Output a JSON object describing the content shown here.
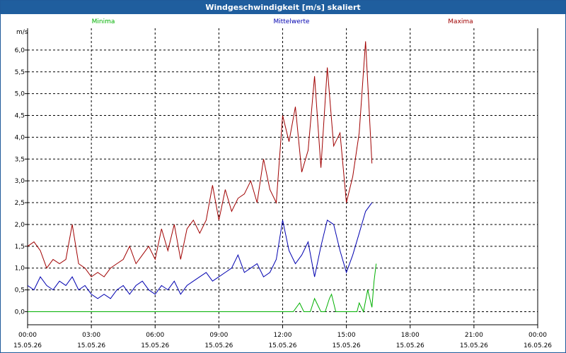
{
  "window": {
    "title": "Windgeschwindigkeit [m/s] skaliert"
  },
  "chart_data": {
    "type": "line",
    "ylabel": "m/s",
    "ylim": [
      -0.3,
      6.5
    ],
    "yticks": [
      "0,0",
      "0,5",
      "1,0",
      "1,5",
      "2,0",
      "2,5",
      "3,0",
      "3,5",
      "4,0",
      "4,5",
      "5,0",
      "5,5",
      "6,0"
    ],
    "ytick_values": [
      0,
      0.5,
      1,
      1.5,
      2,
      2.5,
      3,
      3.5,
      4,
      4.5,
      5,
      5.5,
      6
    ],
    "xlim_hours": [
      0,
      24
    ],
    "xticks": [
      {
        "time": "00:00",
        "date": "15.05.26"
      },
      {
        "time": "03:00",
        "date": "15.05.26"
      },
      {
        "time": "06:00",
        "date": "15.05.26"
      },
      {
        "time": "09:00",
        "date": "15.05.26"
      },
      {
        "time": "12:00",
        "date": "15.05.26"
      },
      {
        "time": "15:00",
        "date": "15.05.26"
      },
      {
        "time": "18:00",
        "date": "15.05.26"
      },
      {
        "time": "21:00",
        "date": "15.05.26"
      },
      {
        "time": "00:00",
        "date": "16.05.26"
      }
    ],
    "grid": true,
    "legend_placement": "top",
    "series": [
      {
        "name": "Minima",
        "color": "#00b000",
        "x": [
          0,
          12,
          12.5,
          12.8,
          13,
          13.3,
          13.5,
          13.8,
          14,
          14.2,
          14.3,
          14.5,
          14.8,
          15,
          15.2,
          15.5,
          15.6,
          15.8,
          16,
          16.2,
          16.3,
          16.4
        ],
        "y": [
          0,
          0,
          0,
          0.2,
          0,
          0,
          0.3,
          0,
          0,
          0.3,
          0.4,
          0,
          0,
          0,
          0,
          0,
          0.2,
          0,
          0.5,
          0.1,
          0.7,
          1.1
        ]
      },
      {
        "name": "Mittelwerte",
        "color": "#0000b0",
        "x": [
          0,
          0.3,
          0.6,
          0.9,
          1.2,
          1.5,
          1.8,
          2.1,
          2.4,
          2.7,
          3,
          3.3,
          3.6,
          3.9,
          4.2,
          4.5,
          4.8,
          5.1,
          5.4,
          5.7,
          6,
          6.3,
          6.6,
          6.9,
          7.2,
          7.5,
          7.8,
          8.1,
          8.4,
          8.7,
          9,
          9.3,
          9.6,
          9.9,
          10.2,
          10.5,
          10.8,
          11.1,
          11.4,
          11.7,
          12,
          12.3,
          12.6,
          12.9,
          13.2,
          13.5,
          13.8,
          14.1,
          14.4,
          14.7,
          15,
          15.3,
          15.6,
          15.9,
          16.2
        ],
        "y": [
          0.6,
          0.5,
          0.8,
          0.6,
          0.5,
          0.7,
          0.6,
          0.8,
          0.5,
          0.6,
          0.4,
          0.3,
          0.4,
          0.3,
          0.5,
          0.6,
          0.4,
          0.6,
          0.7,
          0.5,
          0.4,
          0.6,
          0.5,
          0.7,
          0.4,
          0.6,
          0.7,
          0.8,
          0.9,
          0.7,
          0.8,
          0.9,
          1.0,
          1.3,
          0.9,
          1.0,
          1.1,
          0.8,
          0.9,
          1.2,
          2.1,
          1.4,
          1.1,
          1.3,
          1.6,
          0.8,
          1.5,
          2.1,
          2.0,
          1.4,
          0.9,
          1.3,
          1.8,
          2.3,
          2.5
        ]
      },
      {
        "name": "Maxima",
        "color": "#a00000",
        "x": [
          0,
          0.3,
          0.6,
          0.9,
          1.2,
          1.5,
          1.8,
          2.1,
          2.4,
          2.7,
          3,
          3.3,
          3.6,
          3.9,
          4.2,
          4.5,
          4.8,
          5.1,
          5.4,
          5.7,
          6,
          6.3,
          6.6,
          6.9,
          7.2,
          7.5,
          7.8,
          8.1,
          8.4,
          8.7,
          9,
          9.3,
          9.6,
          9.9,
          10.2,
          10.5,
          10.8,
          11.1,
          11.4,
          11.7,
          12,
          12.3,
          12.6,
          12.9,
          13.2,
          13.5,
          13.8,
          14.1,
          14.4,
          14.7,
          15,
          15.3,
          15.6,
          15.9,
          16.2
        ],
        "y": [
          1.5,
          1.6,
          1.4,
          1.0,
          1.2,
          1.1,
          1.2,
          2.0,
          1.1,
          1.0,
          0.8,
          0.9,
          0.8,
          1.0,
          1.1,
          1.2,
          1.5,
          1.1,
          1.3,
          1.5,
          1.2,
          1.9,
          1.4,
          2.0,
          1.2,
          1.9,
          2.1,
          1.8,
          2.1,
          2.9,
          2.1,
          2.8,
          2.3,
          2.6,
          2.7,
          3.0,
          2.5,
          3.5,
          2.8,
          2.5,
          4.5,
          3.9,
          4.7,
          3.2,
          3.7,
          5.4,
          3.3,
          5.6,
          3.8,
          4.1,
          2.5,
          3.1,
          4.1,
          6.2,
          3.4
        ]
      }
    ]
  }
}
